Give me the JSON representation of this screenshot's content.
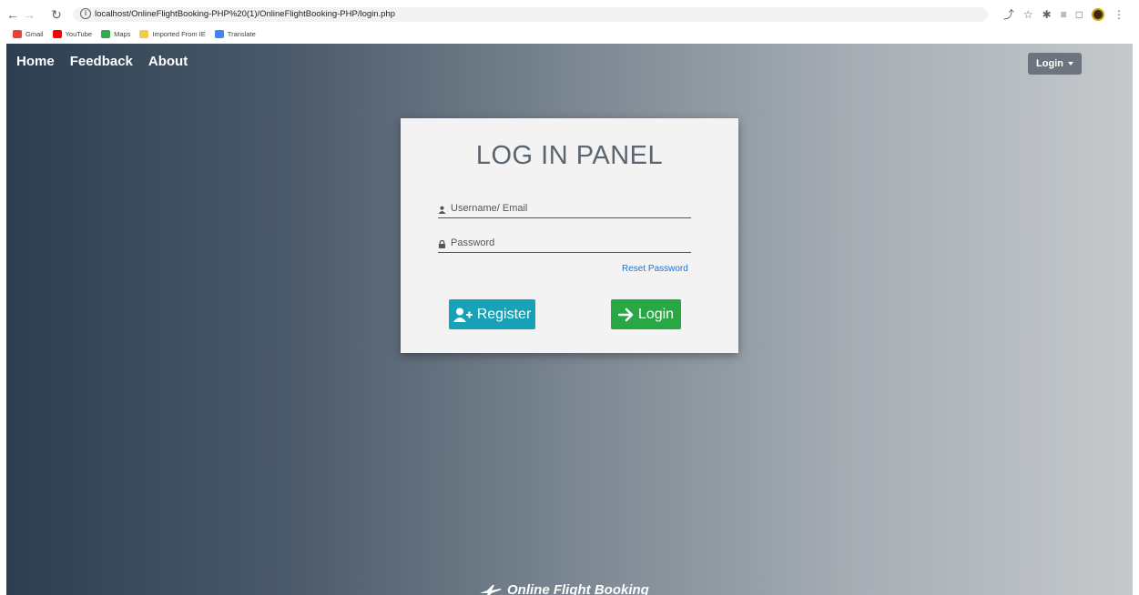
{
  "browser": {
    "url": "localhost/OnlineFlightBooking-PHP%20(1)/OnlineFlightBooking-PHP/login.php",
    "bookmarks": [
      {
        "label": "Gmail",
        "color": "#ea4335"
      },
      {
        "label": "YouTube",
        "color": "#ff0000"
      },
      {
        "label": "Maps",
        "color": "#34a853"
      },
      {
        "label": "Imported From IE",
        "color": "#f7c948"
      },
      {
        "label": "Translate",
        "color": "#4285f4"
      }
    ]
  },
  "nav": {
    "items": [
      "Home",
      "Feedback",
      "About"
    ],
    "login_dropdown": "Login"
  },
  "panel": {
    "title": "LOG IN PANEL",
    "username_placeholder": "Username/ Email",
    "password_placeholder": "Password",
    "reset_link": "Reset Password",
    "register_label": "Register",
    "login_label": "Login"
  },
  "footer": {
    "brand": "Online Flight Booking"
  },
  "colors": {
    "register": "#17a2b8",
    "login": "#28a745",
    "dropdown": "#6c757d",
    "gradient_start": "#2c3e50",
    "gradient_end": "#c5c9cc"
  }
}
